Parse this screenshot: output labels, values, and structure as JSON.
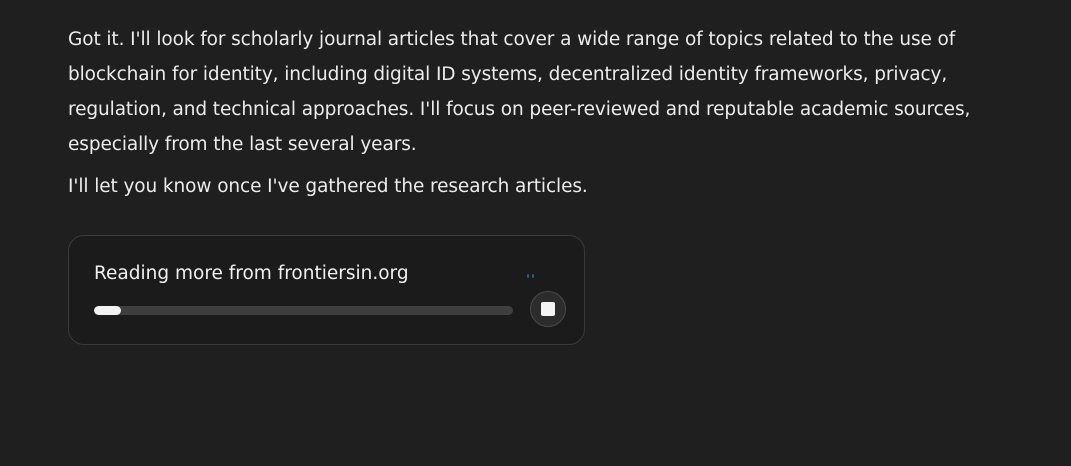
{
  "message": {
    "paragraphs": [
      "Got it. I'll look for scholarly journal articles that cover a wide range of topics related to the use of blockchain for identity, including digital ID systems, decentralized identity frameworks, privacy, regulation, and technical approaches. I'll focus on peer-reviewed and reputable academic sources, especially from the last several years.",
      "I'll let you know once I've gathered the research articles."
    ]
  },
  "status_card": {
    "text": "Reading more from frontiersin.org",
    "progress_fraction": 0.065,
    "stop_icon": "stop-icon"
  },
  "colors": {
    "background": "#1f1f1f",
    "text": "#ececec",
    "progress_fill": "#f2f2f2",
    "progress_track": "#3e3e3e",
    "loading_accent": "#2a6fa8"
  }
}
